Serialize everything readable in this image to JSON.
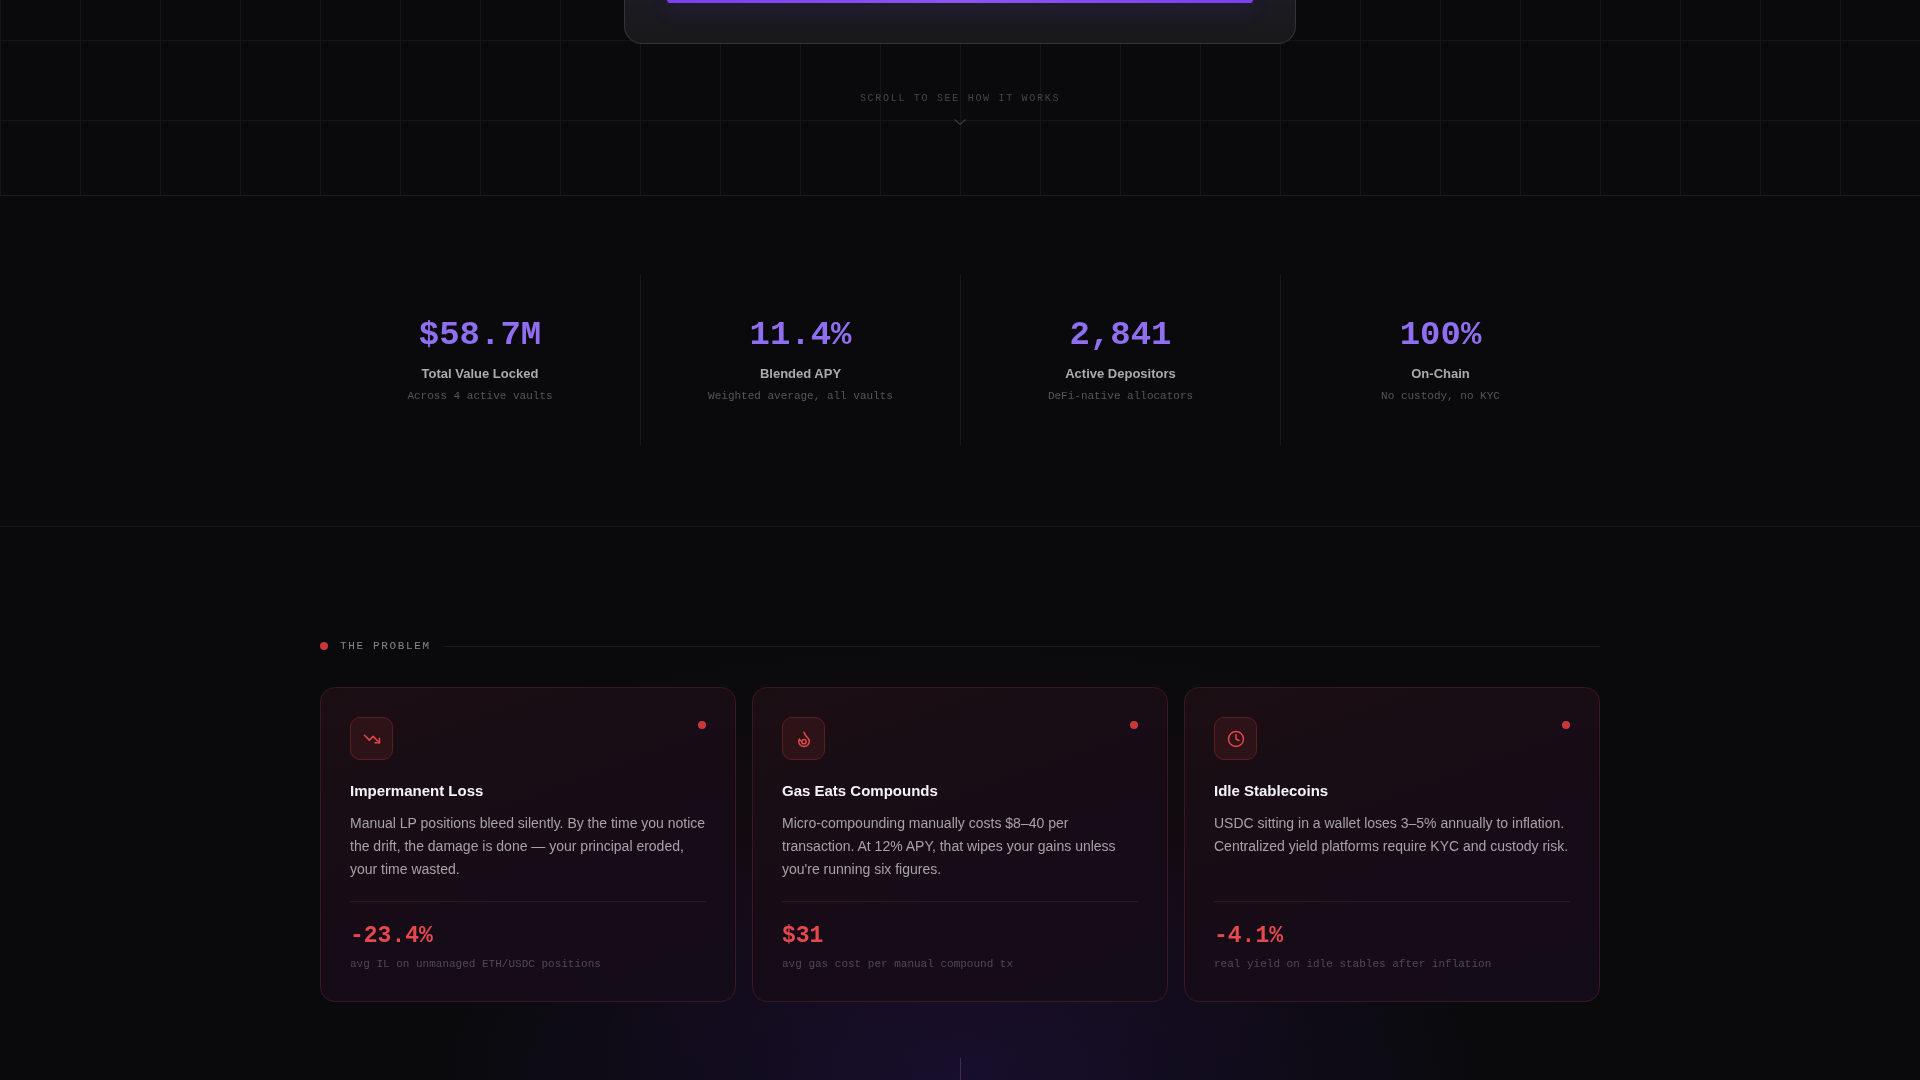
{
  "hero": {
    "scroll_hint": "SCROLL TO SEE HOW IT WORKS"
  },
  "stats": [
    {
      "value": "$58.7M",
      "label": "Total Value Locked",
      "note": "Across 4 active vaults"
    },
    {
      "value": "11.4%",
      "label": "Blended APY",
      "note": "Weighted average, all vaults"
    },
    {
      "value": "2,841",
      "label": "Active Depositors",
      "note": "DeFi-native allocators"
    },
    {
      "value": "100%",
      "label": "On-Chain",
      "note": "No custody, no KYC"
    }
  ],
  "problem": {
    "eyebrow": "THE PROBLEM",
    "cards": [
      {
        "kind": "trend-down",
        "title": "Impermanent Loss",
        "description": "Manual LP positions bleed silently. By the time you notice the drift, the damage is done — your principal eroded, your time wasted.",
        "metric": "-23.4%",
        "metric_caption": "avg IL on unmanaged ETH/USDC positions"
      },
      {
        "kind": "flame",
        "title": "Gas Eats Compounds",
        "description": "Micro-compounding manually costs $8–40 per transaction. At 12% APY, that wipes your gains unless you're running six figures.",
        "metric": "$31",
        "metric_caption": "avg gas cost per manual compound tx"
      },
      {
        "kind": "clock",
        "title": "Idle Stablecoins",
        "description": "USDC sitting in a wallet loses 3–5% annually to inflation. Centralized yield platforms require KYC and custody risk.",
        "metric": "-4.1%",
        "metric_caption": "real yield on idle stables after inflation"
      }
    ]
  }
}
